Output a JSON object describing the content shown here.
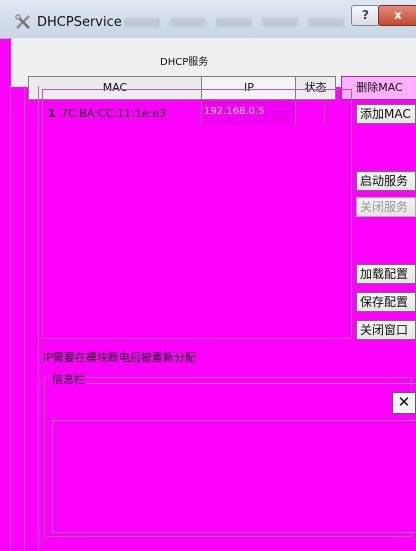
{
  "window": {
    "title": "DHCPService",
    "help_label": "?",
    "close_label": "x"
  },
  "header": {
    "section_title": "DHCP服务"
  },
  "table": {
    "columns": [
      "MAC",
      "IP",
      "状态",
      "删除MAC"
    ],
    "rows": [
      {
        "num": "1",
        "mac": "7C:BA:CC:11:1e:e3",
        "ip": "192.168.0.5"
      }
    ]
  },
  "buttons": {
    "add_mac": "添加MAC",
    "start_service": "启动服务",
    "stop_service": "关闭服务",
    "load_config": "加载配置",
    "save_config": "保存配置",
    "close_window": "关闭窗口"
  },
  "note": "IP需要在模块断电后被重新分配",
  "info": {
    "title": "信息栏",
    "close_label": "✕"
  },
  "colors": {
    "background": "#ff00ff",
    "titlebar": "#d4deea",
    "close_button": "#c8513b"
  },
  "icons": [
    "app-icon",
    "help-icon",
    "close-icon"
  ]
}
